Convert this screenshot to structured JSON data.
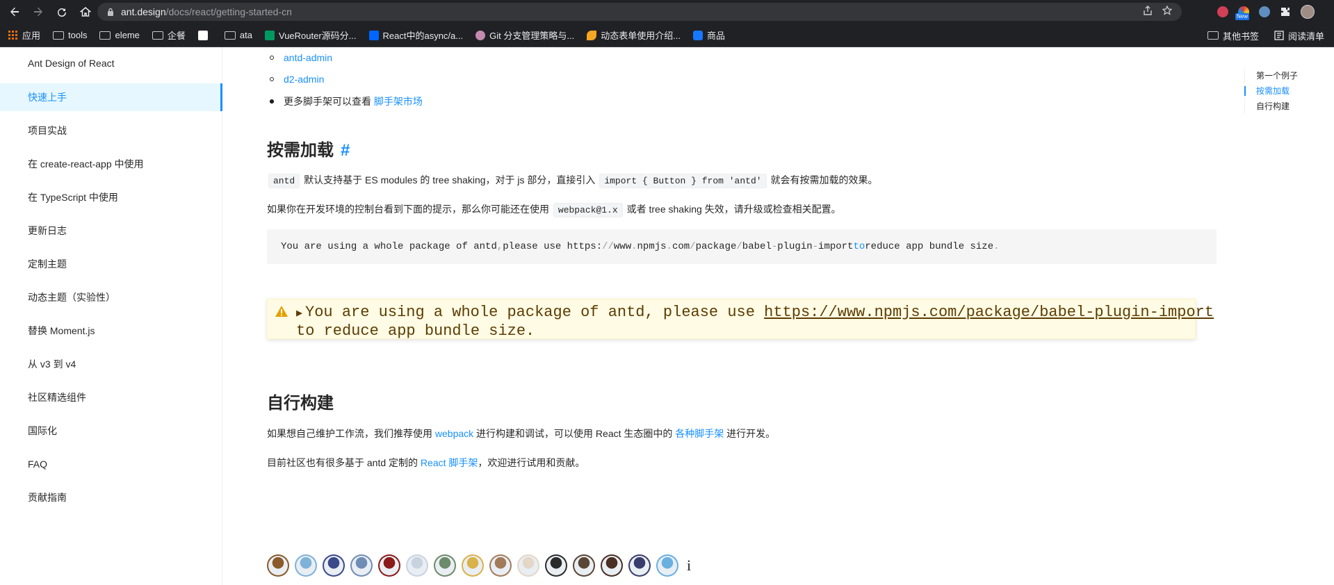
{
  "browser": {
    "url_host": "ant.design",
    "url_path": "/docs/react/getting-started-cn",
    "badge_new": "New",
    "bookmarks": [
      {
        "label": "应用",
        "icon": "apps-grid-icon"
      },
      {
        "label": "tools",
        "icon": "folder-icon"
      },
      {
        "label": "eleme",
        "icon": "folder-icon"
      },
      {
        "label": "企餐",
        "icon": "folder-icon"
      },
      {
        "label": "",
        "icon": "site-favicon"
      },
      {
        "label": "ata",
        "icon": "folder-icon"
      },
      {
        "label": "VueRouter源码分...",
        "icon": "segmentfault-icon"
      },
      {
        "label": "React中的async/a...",
        "icon": "zhihu-icon"
      },
      {
        "label": "Git 分支管理策略与...",
        "icon": "site-favicon"
      },
      {
        "label": "动态表单使用介绍...",
        "icon": "site-favicon"
      },
      {
        "label": "商品",
        "icon": "site-favicon"
      }
    ],
    "bookmarks_right": {
      "other": "其他书签",
      "reading_list": "阅读清单"
    }
  },
  "sidebar": {
    "items": [
      {
        "label": "Ant Design of React",
        "active": false
      },
      {
        "label": "快速上手",
        "active": true
      },
      {
        "label": "项目实战",
        "active": false
      },
      {
        "label": "在 create-react-app 中使用",
        "active": false
      },
      {
        "label": "在 TypeScript 中使用",
        "active": false
      },
      {
        "label": "更新日志",
        "active": false
      },
      {
        "label": "定制主题",
        "active": false
      },
      {
        "label": "动态主题（实验性）",
        "active": false
      },
      {
        "label": "替换 Moment.js",
        "active": false
      },
      {
        "label": "从 v3 到 v4",
        "active": false
      },
      {
        "label": "社区精选组件",
        "active": false
      },
      {
        "label": "国际化",
        "active": false
      },
      {
        "label": "FAQ",
        "active": false
      },
      {
        "label": "贡献指南",
        "active": false
      }
    ]
  },
  "main": {
    "list": {
      "item1": "antd-admin",
      "item2": "d2-admin",
      "item3_prefix": "更多脚手架可以查看 ",
      "item3_link": "脚手架市场"
    },
    "section1": {
      "title": "按需加载",
      "anchor": "#",
      "p1_code1": "antd",
      "p1_text1": " 默认支持基于 ES modules 的 tree shaking，对于 js 部分，直接引入 ",
      "p1_code2": "import { Button } from 'antd'",
      "p1_text2": " 就会有按需加载的效果。",
      "p2_text1": "如果你在开发环境的控制台看到下面的提示，那么你可能还在使用 ",
      "p2_code": "webpack@1.x",
      "p2_text2": " 或者 tree shaking 失效，请升级或检查相关配置。",
      "code": {
        "part1": "You are using a whole package of antd",
        "comma": ",",
        "part2": " please use https:",
        "slashes": "//",
        "part3": "www",
        "dot1": ".",
        "part4": "npmjs",
        "dot2": ".",
        "part5": "com",
        "slash1": "/",
        "part6": "package",
        "slash2": "/",
        "part7": "babel",
        "dash1": "-",
        "part8": "plugin",
        "dash2": "-",
        "part9": "import ",
        "to": "to",
        "part10": " reduce app bundle size",
        "dot3": "."
      },
      "warning": {
        "line1_prefix": "You are using a whole package of antd, please use ",
        "link": "https://www.npmjs.com/package/babel-plugin-import",
        "line2": "to reduce app bundle size."
      }
    },
    "section2": {
      "title": "自行构建",
      "p1_text1": "如果想自己维护工作流，我们推荐使用 ",
      "p1_link1": "webpack",
      "p1_text2": " 进行构建和调试，可以使用 React 生态圈中的 ",
      "p1_link2": "各种脚手架",
      "p1_text3": " 进行开发。",
      "p2_text1": "目前社区也有很多基于 antd 定制的 ",
      "p2_link": "React 脚手架",
      "p2_text2": "，欢迎进行试用和贡献。"
    },
    "contributors_more": "i"
  },
  "toc": {
    "items": [
      {
        "label": "第一个例子",
        "active": false
      },
      {
        "label": "按需加载",
        "active": true
      },
      {
        "label": "自行构建",
        "active": false
      }
    ]
  },
  "colors": {
    "primary": "#1890ff",
    "active_bg": "#e6f7ff",
    "warning_bg": "#fffbe5",
    "browser_dark": "#202124",
    "contributors": [
      "#8a5a2b",
      "#7fb2d8",
      "#3b4a8a",
      "#6f8db5",
      "#8b1a1a",
      "#c9d3e0",
      "#6d8a6a",
      "#d9b24a",
      "#a37b5a",
      "#e4d7c6",
      "#2b2b2b",
      "#5a4636",
      "#4a2f23",
      "#3a3d6b",
      "#6ab0e0"
    ]
  }
}
